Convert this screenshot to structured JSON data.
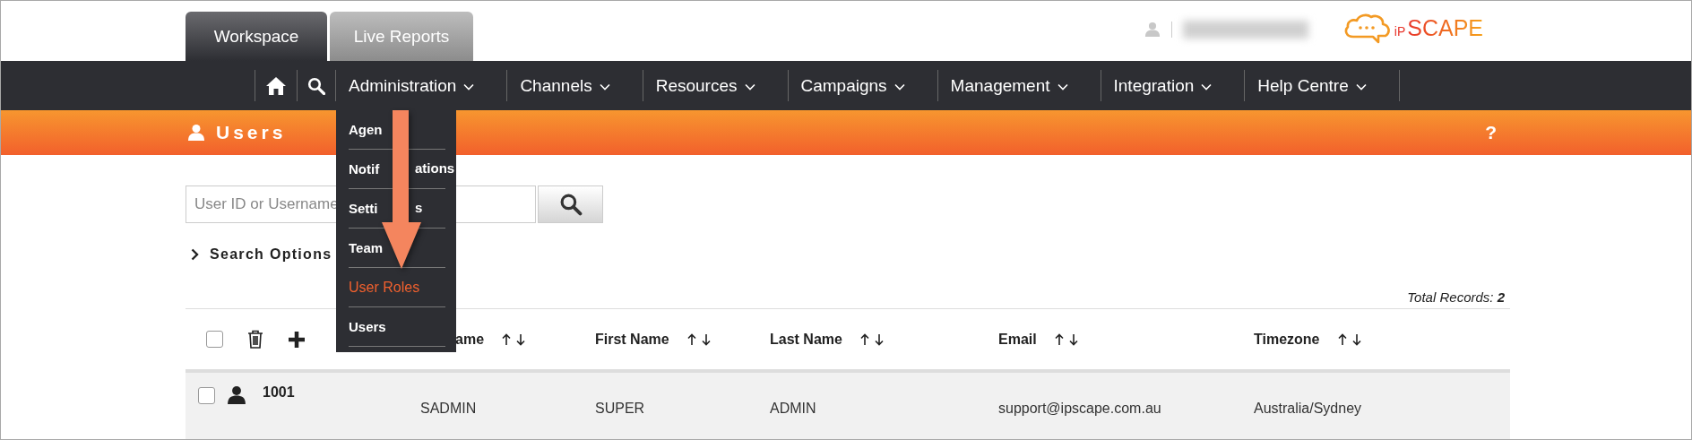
{
  "top_tabs": [
    {
      "label": "Workspace",
      "selected": true
    },
    {
      "label": "Live Reports",
      "selected": false
    }
  ],
  "logo": {
    "prefix": "iP",
    "name": "SCAPE"
  },
  "nav": {
    "items": [
      {
        "label": "Administration",
        "expanded": true
      },
      {
        "label": "Channels",
        "expanded": false
      },
      {
        "label": "Resources",
        "expanded": false
      },
      {
        "label": "Campaigns",
        "expanded": false
      },
      {
        "label": "Management",
        "expanded": false
      },
      {
        "label": "Integration",
        "expanded": false
      },
      {
        "label": "Help Centre",
        "expanded": false
      }
    ]
  },
  "admin_menu": [
    {
      "label": "Agen",
      "selected": false
    },
    {
      "label": "Notif",
      "tail": "ations",
      "selected": false
    },
    {
      "label": "Setti",
      "tail": "s",
      "selected": false
    },
    {
      "label": "Team",
      "selected": false
    },
    {
      "label": "User Roles",
      "selected": true
    },
    {
      "label": "Users",
      "selected": false
    }
  ],
  "page_title": "Users",
  "help": "?",
  "search": {
    "placeholder": "User ID or Username"
  },
  "search_options": "Search Options",
  "total_records": "Total Records: **2**",
  "table": {
    "select_all": {
      "checked": false
    },
    "columns": [
      "ame",
      "First Name",
      "Last Name",
      "Email",
      "Timezone"
    ],
    "rows": [
      {
        "checked": false,
        "id": "1001",
        "cells": [
          "SADMIN",
          "SUPER",
          "ADMIN",
          "support@ipscape.com.au",
          "Australia/Sydney"
        ]
      }
    ]
  }
}
